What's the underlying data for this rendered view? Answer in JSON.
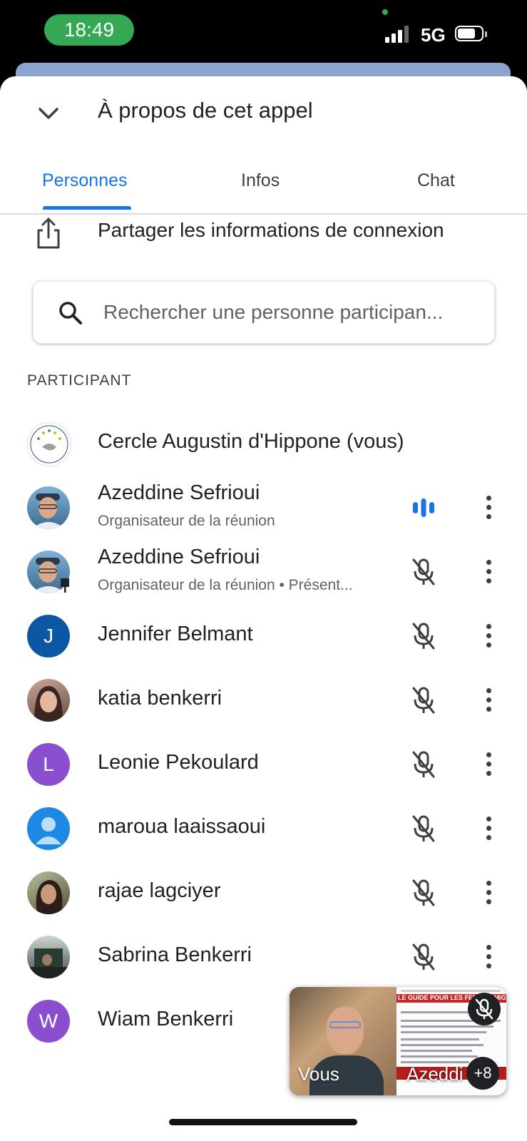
{
  "status_bar": {
    "time": "18:49",
    "network": "5G",
    "signal_bars_active": 3,
    "signal_bars_total": 4,
    "battery_level": 0.6
  },
  "sheet": {
    "title": "À propos de cet appel",
    "collapse_icon": "chevron-down-icon"
  },
  "tabs": [
    {
      "label": "Personnes",
      "active": true
    },
    {
      "label": "Infos",
      "active": false
    },
    {
      "label": "Chat",
      "active": false
    }
  ],
  "share": {
    "label": "Partager les informations de connexion",
    "icon": "share-icon"
  },
  "search": {
    "placeholder": "Rechercher une personne participan...",
    "icon": "search-icon"
  },
  "section_label": "PARTICIPANT",
  "participants": [
    {
      "name": "Cercle Augustin d'Hippone (vous)",
      "subtitle": "",
      "avatar": "logo-avatar",
      "mic": "none"
    },
    {
      "name": "Azeddine Sefrioui",
      "subtitle": "Organisateur de la réunion",
      "avatar": "photo-avatar",
      "mic": "speaking-icon"
    },
    {
      "name": "Azeddine Sefrioui",
      "subtitle": "Organisateur de la réunion • Présent...",
      "avatar": "photo-avatar",
      "mic": "mic-off-icon"
    },
    {
      "name": "Jennifer Belmant",
      "subtitle": "",
      "avatar": "J",
      "avatar_color": "#0b57a4",
      "mic": "mic-off-icon"
    },
    {
      "name": "katia benkerri",
      "subtitle": "",
      "avatar": "photo-avatar",
      "mic": "mic-off-icon"
    },
    {
      "name": "Leonie Pekoulard",
      "subtitle": "",
      "avatar": "L",
      "avatar_color": "#8a4fcf",
      "mic": "mic-off-icon"
    },
    {
      "name": "maroua laaissaoui",
      "subtitle": "",
      "avatar": "default-person-avatar",
      "avatar_color": "#1e88e5",
      "mic": "mic-off-icon"
    },
    {
      "name": "rajae lagciyer",
      "subtitle": "",
      "avatar": "photo-avatar",
      "mic": "mic-off-icon"
    },
    {
      "name": "Sabrina Benkerri",
      "subtitle": "",
      "avatar": "photo-avatar",
      "mic": "mic-off-icon"
    },
    {
      "name": "Wiam Benkerri",
      "subtitle": "",
      "avatar": "W",
      "avatar_color": "#8a4fcf",
      "mic": "hidden"
    }
  ],
  "pip": {
    "self_label": "Vous",
    "other_label": "Azeddi",
    "more_count": "+8",
    "doc_title": "LE GUIDE POUR LES FEMMES MIGRA",
    "muted_icon": "mic-off-icon"
  },
  "colors": {
    "accent": "#1a73e8",
    "status_time_bg": "#34a853"
  }
}
